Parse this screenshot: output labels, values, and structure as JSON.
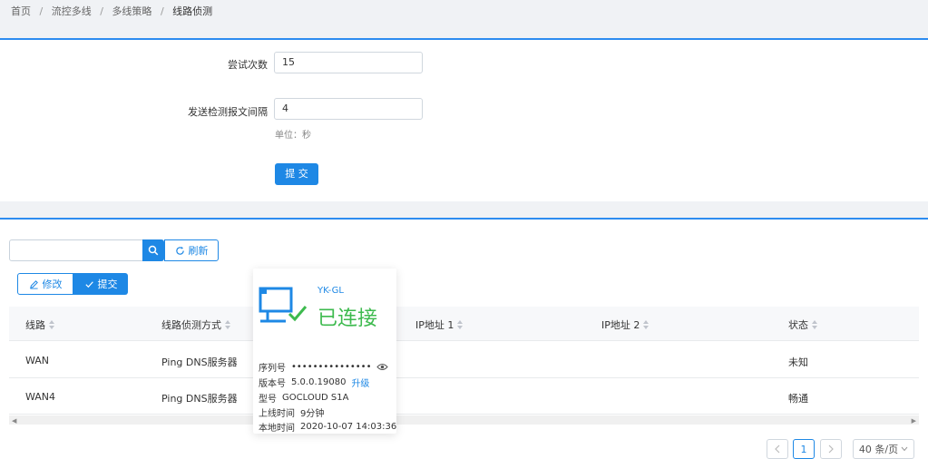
{
  "breadcrumb": [
    "首页",
    "流控多线",
    "多线策略",
    "线路侦测"
  ],
  "breadcrumb_separator": "/",
  "form": {
    "attempts_label": "尝试次数",
    "attempts_value": "15",
    "interval_label": "发送检测报文间隔",
    "interval_value": "4",
    "unit_hint": "单位：秒",
    "submit_label": "提 交"
  },
  "toolbar": {
    "search_value": "",
    "refresh_label": "刷新",
    "edit_label": "修改",
    "submit_label": "提交"
  },
  "table": {
    "columns": [
      "线路",
      "线路侦测方式",
      "",
      "IP地址 1",
      "IP地址 2",
      "状态"
    ],
    "rows": [
      [
        "WAN",
        "Ping DNS服务器",
        "",
        "",
        "",
        "未知"
      ],
      [
        "WAN4",
        "Ping DNS服务器",
        "",
        "",
        "",
        "畅通"
      ]
    ]
  },
  "pagination": {
    "prev_icon": "chevron-left-icon",
    "current_page": "1",
    "next_icon": "chevron-right-icon",
    "page_size": "40 条/页"
  },
  "device_popup": {
    "name": "YK-GL",
    "status": "已连接",
    "serial_label": "序列号",
    "serial_value": "•••••••••••••••",
    "version_label": "版本号",
    "version_value": "5.0.0.19080",
    "upgrade_label": "升级",
    "model_label": "型号",
    "model_value": "GOCLOUD S1A",
    "uptime_label": "上线时间",
    "uptime_value": "9分钟",
    "localtime_label": "本地时间",
    "localtime_value": "2020-10-07 14:03:36"
  },
  "colors": {
    "primary": "#1e88e5",
    "connected_green": "#3dba4e",
    "background": "#f0f2f5"
  }
}
